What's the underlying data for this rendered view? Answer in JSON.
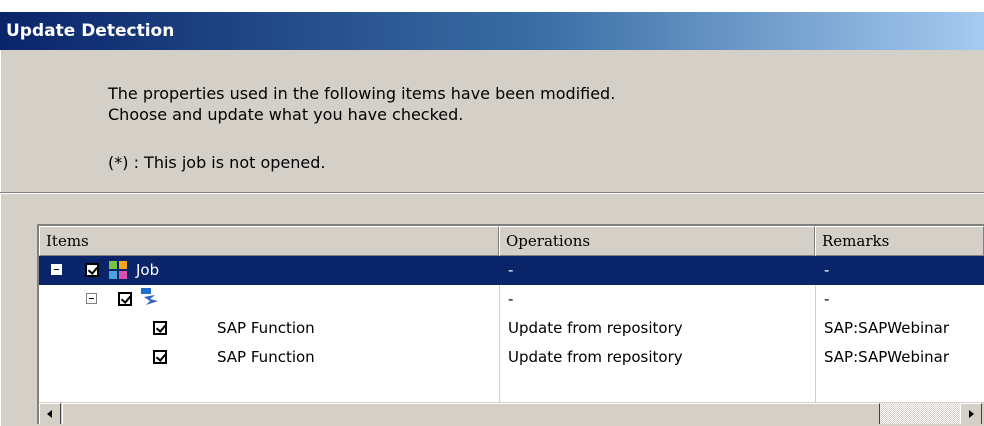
{
  "window": {
    "title": "Update Detection"
  },
  "message": {
    "line1": "The properties used in the following items have been modified.",
    "line2": "Choose and update what you have checked.",
    "note": "(*) : This job is not opened."
  },
  "table": {
    "columns": [
      "Items",
      "Operations",
      "Remarks"
    ],
    "rows": [
      {
        "item": "Job",
        "operation": "-",
        "remark": "-",
        "checked": true,
        "selected": true,
        "icon": "job-icon"
      },
      {
        "item": "",
        "operation": "-",
        "remark": "-",
        "checked": true,
        "selected": false,
        "icon": "sap-connection-icon"
      },
      {
        "item": "SAP Function",
        "operation": "Update from repository",
        "remark": "SAP:SAPWebinar",
        "checked": true,
        "selected": false
      },
      {
        "item": "SAP Function",
        "operation": "Update from repository",
        "remark": "SAP:SAPWebinar",
        "checked": true,
        "selected": false
      }
    ]
  },
  "colors": {
    "selection": "#0a246a",
    "dialog_bg": "#d4d0c8",
    "title_gradient_start": "#0a246a",
    "title_gradient_end": "#a6caf0"
  }
}
